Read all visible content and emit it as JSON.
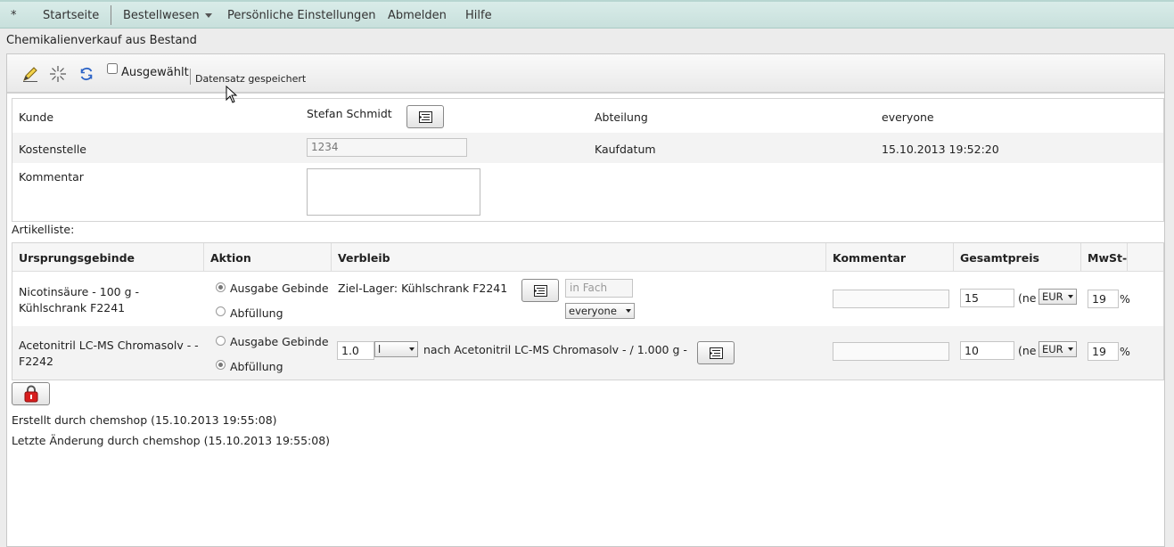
{
  "menu": {
    "star": "*",
    "home": "Startseite",
    "orders": "Bestellwesen",
    "settings": "Persönliche Einstellungen",
    "logout": "Abmelden",
    "help": "Hilfe"
  },
  "page_title": "Chemikalienverkauf aus Bestand",
  "toolbar": {
    "icons": [
      "edit-pencil-icon",
      "sparkle-new-icon",
      "refresh-icon"
    ],
    "selected_label": "Ausgewählt",
    "selected_checked": false,
    "status_message": "Datensatz gespeichert"
  },
  "form": {
    "customer_label": "Kunde",
    "customer_value": "Stefan Schmidt",
    "department_label": "Abteilung",
    "department_value": "everyone",
    "cost_center_label": "Kostenstelle",
    "cost_center_value": "1234",
    "purchase_date_label": "Kaufdatum",
    "purchase_date_value": "15.10.2013 19:52:20",
    "comment_label": "Kommentar",
    "comment_value": ""
  },
  "article_list_label": "Artikelliste:",
  "table": {
    "headers": {
      "origin": "Ursprungsgebinde",
      "action": "Aktion",
      "destination": "Verbleib",
      "comment": "Kommentar",
      "total_price": "Gesamtpreis",
      "vat": "MwSt-S"
    },
    "rows": [
      {
        "origin_line1": "Nicotinsäure - 100 g -",
        "origin_line2": "Kühlschrank F2241",
        "action_option1": "Ausgabe Gebinde",
        "action_option2": "Abfüllung",
        "action_selected": 1,
        "destination_text": "Ziel-Lager: Kühlschrank F2241",
        "compartment_placeholder": "in Fach",
        "group_select": "everyone",
        "comment": "",
        "price": "15",
        "price_suffix": "(ne",
        "currency": "EUR",
        "vat": "19",
        "vat_suffix": "%"
      },
      {
        "origin_line1": "Acetonitril LC-MS Chromasolv - -",
        "origin_line2": "F2242",
        "action_option1": "Ausgabe Gebinde",
        "action_option2": "Abfüllung",
        "action_selected": 2,
        "amount": "1.0",
        "unit": "l",
        "destination_text": "nach Acetonitril LC-MS Chromasolv - / 1.000 g -",
        "comment": "",
        "price": "10",
        "price_suffix": "(ne",
        "currency": "EUR",
        "vat": "19",
        "vat_suffix": "%"
      }
    ]
  },
  "footer": {
    "created": "Erstellt durch chemshop (15.10.2013 19:55:08)",
    "modified": "Letzte Änderung durch chemshop (15.10.2013 19:55:08)"
  },
  "colors": {
    "menubar": "#c8e0dc",
    "lock_red": "#d81e1e"
  }
}
